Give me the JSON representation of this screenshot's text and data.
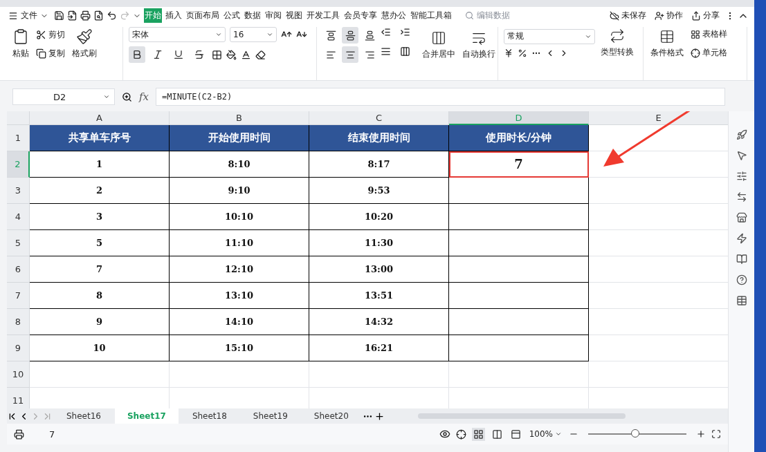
{
  "menu": {
    "file_label": "文件",
    "tabs": [
      {
        "label": "开始",
        "selected": true
      },
      {
        "label": "插入",
        "selected": false
      },
      {
        "label": "页面布局",
        "selected": false
      },
      {
        "label": "公式",
        "selected": false
      },
      {
        "label": "数据",
        "selected": false
      },
      {
        "label": "审阅",
        "selected": false
      },
      {
        "label": "视图",
        "selected": false
      },
      {
        "label": "开发工具",
        "selected": false
      },
      {
        "label": "会员专享",
        "selected": false
      },
      {
        "label": "慧办公",
        "selected": false
      },
      {
        "label": "智能工具箱",
        "selected": false
      }
    ],
    "search_placeholder": "编辑数据",
    "actions": [
      {
        "kind": "save",
        "label": "未保存"
      },
      {
        "kind": "share-people",
        "label": "协作"
      },
      {
        "kind": "share",
        "label": "分享"
      }
    ]
  },
  "ribbon": {
    "paste": "粘贴",
    "cut": "剪切",
    "copy": "复制",
    "format_painter": "格式刷",
    "font_name": "宋体",
    "font_size": "16",
    "font_buttons": [
      {
        "kind": "bold",
        "selected": true
      },
      {
        "kind": "italic",
        "selected": false
      },
      {
        "kind": "underline",
        "selected": false
      },
      {
        "kind": "strike",
        "selected": false
      }
    ],
    "align_buttons": [
      {
        "kind": "top",
        "selected": false
      },
      {
        "kind": "middle",
        "selected": true
      },
      {
        "kind": "bottom",
        "selected": false
      },
      {
        "kind": "left",
        "selected": false
      },
      {
        "kind": "center",
        "selected": true
      },
      {
        "kind": "right",
        "selected": false
      }
    ],
    "merge": "合并居中",
    "wrap": "自动换行",
    "number_format": "常规",
    "convert": "类型转换",
    "conditional": "条件格式",
    "table_style": "表格样",
    "cell_style": "单元格"
  },
  "formula": {
    "cell": "D2",
    "fx": "fx",
    "content": "=MINUTE(C2-B2)"
  },
  "grid": {
    "columns": [
      {
        "label": "A",
        "selected": false
      },
      {
        "label": "B",
        "selected": false
      },
      {
        "label": "C",
        "selected": false
      },
      {
        "label": "D",
        "selected": true
      },
      {
        "label": "E",
        "selected": false
      }
    ],
    "rows": [
      {
        "number": "1",
        "selected": false,
        "cells": [
          {
            "text": "共享单车序号",
            "selected": false
          },
          {
            "text": "开始使用时间",
            "selected": false
          },
          {
            "text": "结束使用时间",
            "selected": false
          },
          {
            "text": "使用时长/分钟",
            "selected": false
          }
        ]
      },
      {
        "number": "2",
        "selected": true,
        "cells": [
          {
            "text": "1",
            "selected": false
          },
          {
            "text": "8:10",
            "selected": false
          },
          {
            "text": "8:17",
            "selected": false
          },
          {
            "text": "7",
            "selected": true
          }
        ]
      },
      {
        "number": "3",
        "selected": false,
        "cells": [
          {
            "text": "2",
            "selected": false
          },
          {
            "text": "9:10",
            "selected": false
          },
          {
            "text": "9:53",
            "selected": false
          },
          {
            "selected": false
          }
        ]
      },
      {
        "number": "4",
        "selected": false,
        "cells": [
          {
            "text": "3",
            "selected": false
          },
          {
            "text": "10:10",
            "selected": false
          },
          {
            "text": "10:20",
            "selected": false
          },
          {
            "selected": false
          }
        ]
      },
      {
        "number": "5",
        "selected": false,
        "cells": [
          {
            "text": "5",
            "selected": false
          },
          {
            "text": "11:10",
            "selected": false
          },
          {
            "text": "11:30",
            "selected": false
          },
          {
            "selected": false
          }
        ]
      },
      {
        "number": "6",
        "selected": false,
        "cells": [
          {
            "text": "7",
            "selected": false
          },
          {
            "text": "12:10",
            "selected": false
          },
          {
            "text": "13:00",
            "selected": false
          },
          {
            "selected": false
          }
        ]
      },
      {
        "number": "7",
        "selected": false,
        "cells": [
          {
            "text": "8",
            "selected": false
          },
          {
            "text": "13:10",
            "selected": false
          },
          {
            "text": "13:51",
            "selected": false
          },
          {
            "selected": false
          }
        ]
      },
      {
        "number": "8",
        "selected": false,
        "cells": [
          {
            "text": "9",
            "selected": false
          },
          {
            "text": "14:10",
            "selected": false
          },
          {
            "text": "14:32",
            "selected": false
          },
          {
            "selected": false
          }
        ]
      },
      {
        "number": "9",
        "selected": false,
        "cells": [
          {
            "text": "10",
            "selected": false
          },
          {
            "text": "15:10",
            "selected": false
          },
          {
            "text": "16:21",
            "selected": false
          },
          {
            "selected": false
          }
        ]
      },
      {
        "number": "10",
        "selected": false
      },
      {
        "number": "11",
        "selected": false
      }
    ]
  },
  "sheets": [
    {
      "label": "Sheet16",
      "selected": false
    },
    {
      "label": "Sheet17",
      "selected": true
    },
    {
      "label": "Sheet18",
      "selected": false
    },
    {
      "label": "Sheet19",
      "selected": false
    },
    {
      "label": "Sheet20",
      "selected": false
    }
  ],
  "status": {
    "value": "7",
    "zoom": "100%",
    "level": 0.48
  }
}
